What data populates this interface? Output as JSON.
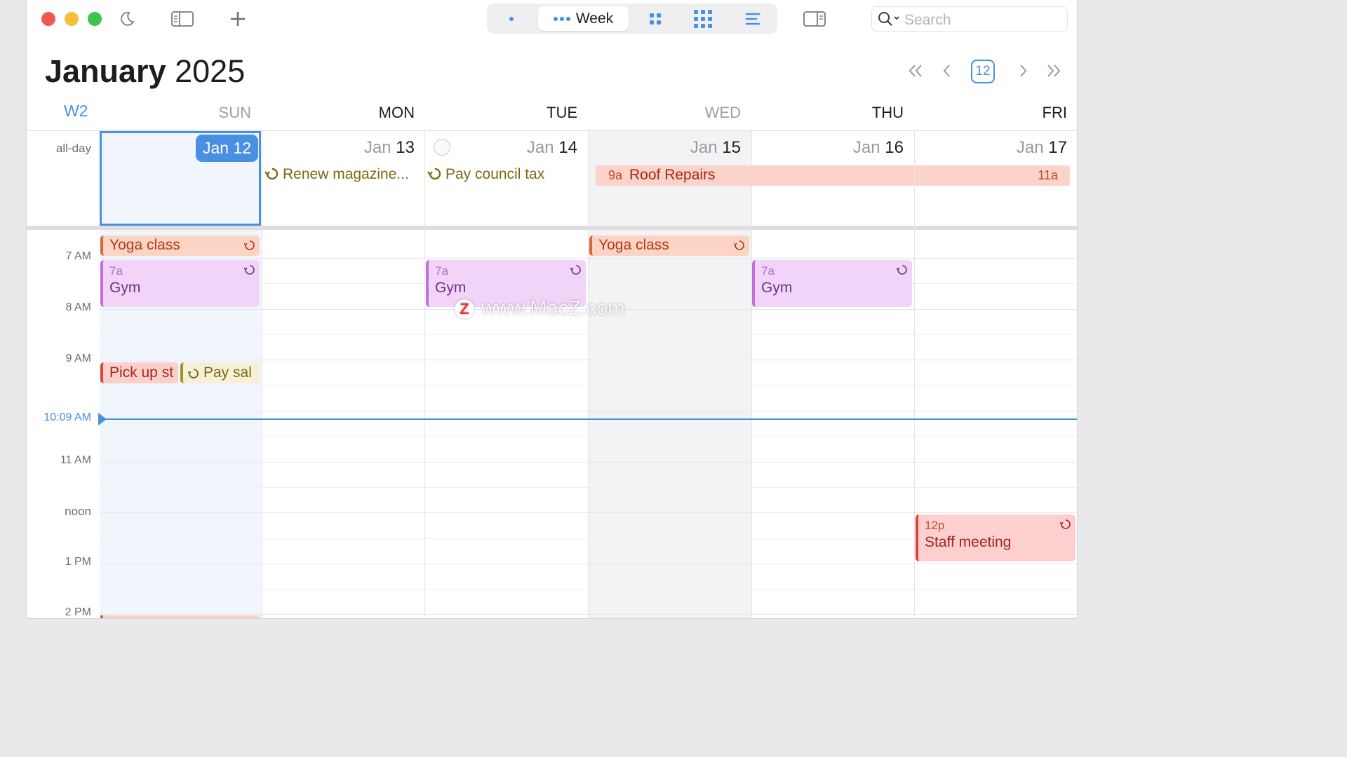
{
  "toolbar": {
    "view_modes": [
      {
        "name": "day",
        "label": ""
      },
      {
        "name": "week",
        "label": "Week",
        "active": true
      },
      {
        "name": "month",
        "label": ""
      },
      {
        "name": "year",
        "label": ""
      },
      {
        "name": "list",
        "label": ""
      }
    ],
    "search_placeholder": "Search",
    "icons": [
      "moon-icon",
      "sidebar-icon",
      "plus-icon",
      "day-view-icon",
      "month-view-icon",
      "year-view-icon",
      "list-view-icon",
      "inspector-icon",
      "search-icon"
    ]
  },
  "header": {
    "month": "January",
    "year": "2025",
    "week_label": "W2",
    "today_badge": "12",
    "nav_icons": [
      "double-chevron-left-icon",
      "chevron-left-icon",
      "chevron-right-icon",
      "double-chevron-right-icon"
    ]
  },
  "days": [
    {
      "name": "SUN",
      "month": "Jan",
      "day": "12",
      "today": true,
      "today_label": "Jan 12"
    },
    {
      "name": "MON",
      "month": "Jan",
      "day": "13"
    },
    {
      "name": "TUE",
      "month": "Jan",
      "day": "14"
    },
    {
      "name": "WED",
      "month": "Jan",
      "day": "15"
    },
    {
      "name": "THU",
      "month": "Jan",
      "day": "16"
    },
    {
      "name": "FRI",
      "month": "Jan",
      "day": "17"
    }
  ],
  "all_day": {
    "label": "all-day",
    "tasks": [
      {
        "day": "MON",
        "title": "Renew magazine..."
      },
      {
        "day": "TUE",
        "title": "Pay council tax"
      }
    ],
    "spanning": {
      "start_time": "9a",
      "title": "Roof Repairs",
      "end_time": "11a"
    }
  },
  "time_labels": [
    "7 AM",
    "8 AM",
    "9 AM",
    "10:09 AM",
    "11 AM",
    "noon",
    "1 PM",
    "2 PM"
  ],
  "current_time": "10:09 AM",
  "events": {
    "yoga_sun": {
      "title": "Yoga class"
    },
    "yoga_wed": {
      "title": "Yoga class"
    },
    "gym_sun": {
      "time": "7a",
      "title": "Gym"
    },
    "gym_tue": {
      "time": "7a",
      "title": "Gym"
    },
    "gym_thu": {
      "time": "7a",
      "title": "Gym"
    },
    "pickup_sun": {
      "title": "Pick up st"
    },
    "paysal_sun": {
      "title": "Pay sal"
    },
    "staff_fri": {
      "time": "12p",
      "title": "Staff meeting"
    }
  },
  "watermark": {
    "logo": "Z",
    "text": "www.MacZ.com"
  },
  "colors": {
    "accent": "#4a90e2",
    "yoga": "#fcd4c6",
    "gym": "#f1d4f8",
    "staff": "#fdd0cf",
    "roof": "#fbd3c8",
    "task": "#7a6a12"
  }
}
